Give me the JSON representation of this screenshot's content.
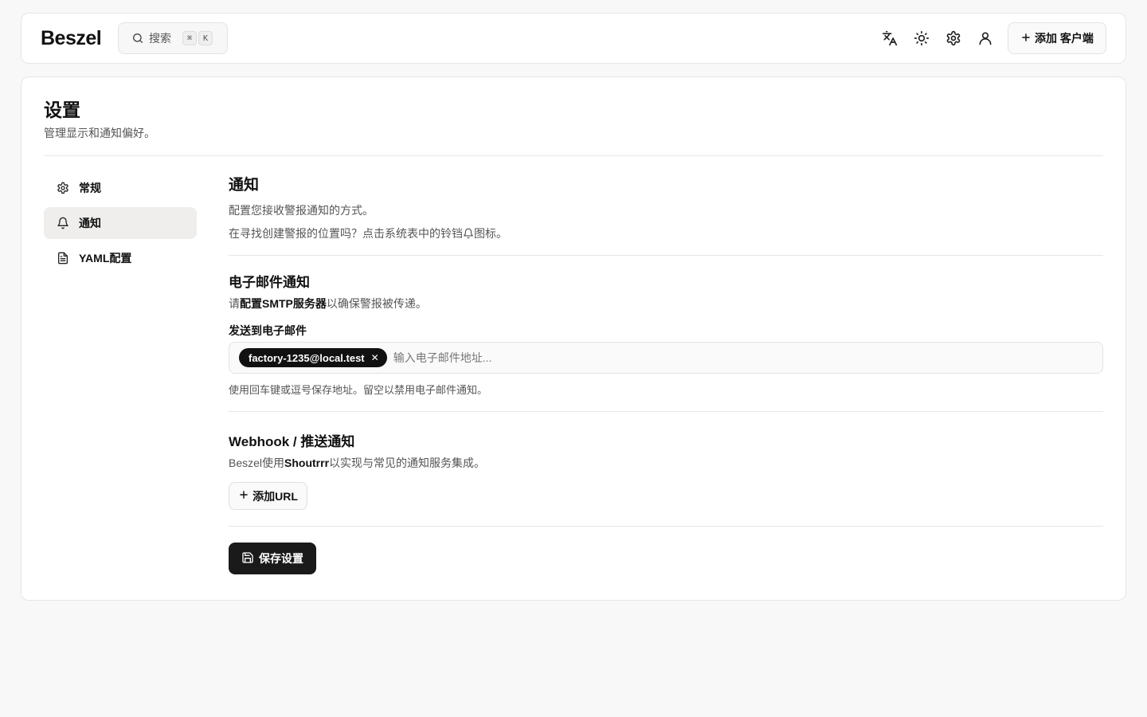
{
  "header": {
    "logo": "Beszel",
    "search": {
      "label": "搜索",
      "kbd1": "⌘",
      "kbd2": "K"
    },
    "icons": [
      "translate-icon",
      "sun-icon",
      "gear-icon",
      "user-icon"
    ],
    "add_client_label": "添加 客户端"
  },
  "page": {
    "title": "设置",
    "subtitle": "管理显示和通知偏好。"
  },
  "sidebar": {
    "items": [
      {
        "label": "常规",
        "icon": "gear-icon",
        "active": false
      },
      {
        "label": "通知",
        "icon": "bell-icon",
        "active": true
      },
      {
        "label": "YAML配置",
        "icon": "file-icon",
        "active": false
      }
    ]
  },
  "notifications": {
    "title": "通知",
    "desc1": "配置您接收警报通知的方式。",
    "desc2_pre": "在寻找创建警报的位置吗？点击系统表中的铃铛",
    "desc2_post": "图标。",
    "email": {
      "title": "电子邮件通知",
      "desc_pre": "请",
      "desc_link": "配置SMTP服务器",
      "desc_post": "以确保警报被传递。",
      "field_label": "发送到电子邮件",
      "chip": "factory-1235@local.test",
      "placeholder": "输入电子邮件地址...",
      "hint": "使用回车键或逗号保存地址。留空以禁用电子邮件通知。"
    },
    "webhook": {
      "title": "Webhook / 推送通知",
      "desc_pre": "Beszel使用",
      "desc_link": "Shoutrrr",
      "desc_post": "以实现与常见的通知服务集成。",
      "add_url_label": "添加URL"
    },
    "save_label": "保存设置"
  },
  "colors": {
    "background": "#f8f8f8",
    "card": "#ffffff",
    "primary_button": "#1a1a1a",
    "active_item": "#efeeed"
  }
}
